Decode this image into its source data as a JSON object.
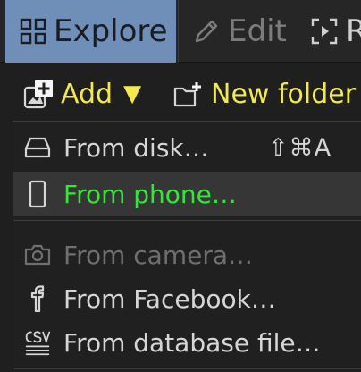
{
  "tabs": [
    {
      "label": "Explore",
      "icon": "grid-icon",
      "active": true
    },
    {
      "label": "Edit",
      "icon": "pencil-icon",
      "active": false
    },
    {
      "label": "R",
      "icon": "review-icon",
      "active": false
    }
  ],
  "toolbar": {
    "add_label": "Add",
    "add_caret": "▼",
    "new_folder_label": "New folder",
    "accent": "#f2e94e"
  },
  "menu": {
    "items": [
      {
        "label": "From disk…",
        "icon": "drive-icon",
        "shortcut": "⇧⌘A",
        "state": "normal"
      },
      {
        "label": "From phone…",
        "icon": "phone-icon",
        "state": "highlighted"
      },
      {
        "label": "From camera…",
        "icon": "camera-icon",
        "state": "disabled"
      },
      {
        "label": "From Facebook…",
        "icon": "facebook-icon",
        "state": "normal"
      },
      {
        "label": "From database file…",
        "icon": "csv-icon",
        "state": "normal"
      }
    ],
    "highlight_color": "#35e63a"
  }
}
